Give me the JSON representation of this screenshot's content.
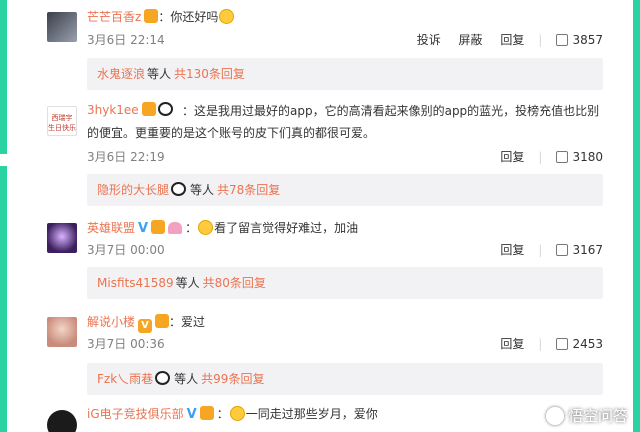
{
  "colors": {
    "accent_border": "#2bd3a3",
    "username": "#eb7350",
    "reply_bg": "#f2f2f5"
  },
  "comments": [
    {
      "username": "芒芒百香z",
      "text": "：你还好吗",
      "emoji": "smile-emoji",
      "time": "3月6日 22:14",
      "report": "投诉",
      "block": "屏蔽",
      "reply": "回复",
      "likes": "3857",
      "reply_summary": {
        "name": "水鬼逐浪",
        "mid": "等人",
        "count": "共130条回复"
      }
    },
    {
      "username": "3hyk1ee",
      "text": "：这是我用过最好的app，它的高清看起来像别的app的蓝光，投榜充值也比别的便宜。更重要的是这个账号的皮下们真的都很可爱。",
      "time": "3月6日 22:19",
      "reply": "回复",
      "likes": "3180",
      "avatar_text": "西瑞宇 生日快乐",
      "reply_summary": {
        "name": "隐形的大长腿",
        "mid": "等人",
        "count": "共78条回复"
      }
    },
    {
      "username": "英雄联盟",
      "text": "看了留言觉得好难过，加油",
      "time": "3月7日 00:00",
      "reply": "回复",
      "likes": "3167",
      "reply_summary": {
        "name": "Misfits41589",
        "mid": "等人",
        "count": "共80条回复"
      }
    },
    {
      "username": "解说小楼",
      "text": "：爱过",
      "time": "3月7日 00:36",
      "reply": "回复",
      "likes": "2453",
      "reply_summary": {
        "name": "Fzk乀雨巷",
        "mid": "等人",
        "count": "共99条回复"
      }
    },
    {
      "username": "iG电子竞技俱乐部",
      "text": "一同走过那些岁月，爱你",
      "emoji": "hug-emoji"
    }
  ],
  "watermark": "悟空问答"
}
